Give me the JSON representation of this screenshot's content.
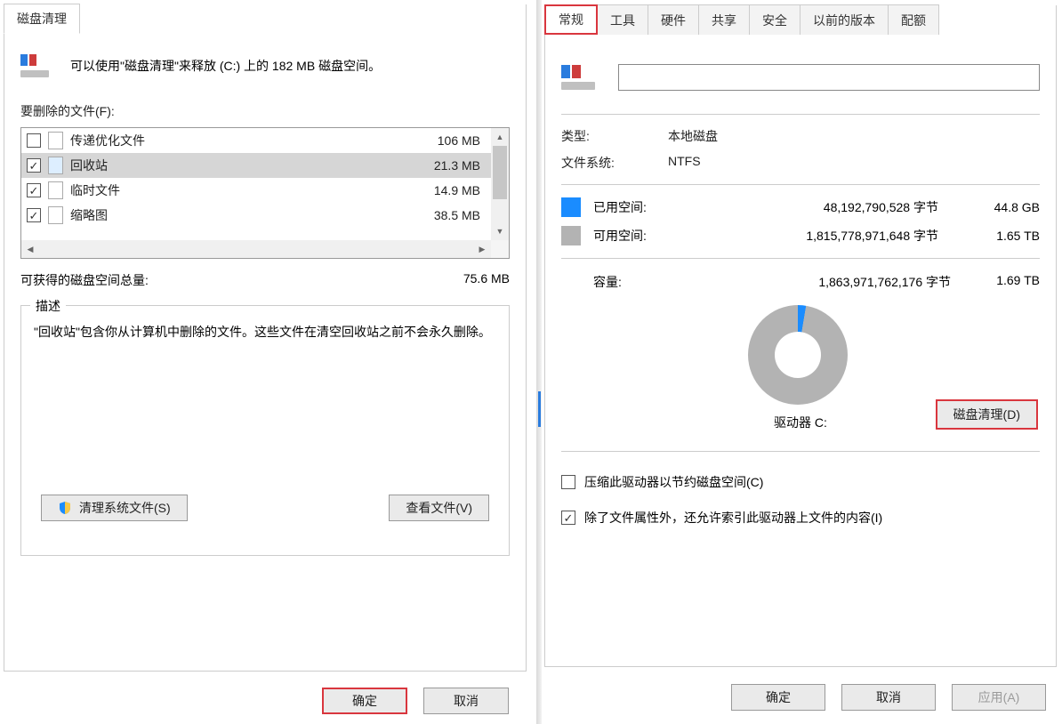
{
  "left": {
    "tab": "磁盘清理",
    "intro": "可以使用\"磁盘清理\"来释放  (C:) 上的 182 MB 磁盘空间。",
    "files_label": "要删除的文件(F):",
    "rows": [
      {
        "checked": false,
        "label": "传递优化文件",
        "size": "106 MB",
        "icon": "file"
      },
      {
        "checked": true,
        "label": "回收站",
        "size": "21.3 MB",
        "icon": "recycle",
        "selected": true
      },
      {
        "checked": true,
        "label": "临时文件",
        "size": "14.9 MB",
        "icon": "file"
      },
      {
        "checked": true,
        "label": "缩略图",
        "size": "38.5 MB",
        "icon": "file"
      }
    ],
    "total_label": "可获得的磁盘空间总量:",
    "total_val": "75.6 MB",
    "desc_title": "描述",
    "desc_text": "\"回收站\"包含你从计算机中删除的文件。这些文件在清空回收站之前不会永久删除。",
    "clean_sys": "清理系统文件(S)",
    "view_files": "查看文件(V)",
    "ok": "确定",
    "cancel": "取消"
  },
  "right": {
    "tabs": [
      "常规",
      "工具",
      "硬件",
      "共享",
      "安全",
      "以前的版本",
      "配额"
    ],
    "active_tab": 0,
    "type_label": "类型:",
    "type_val": "本地磁盘",
    "fs_label": "文件系统:",
    "fs_val": "NTFS",
    "used_label": "已用空间:",
    "used_bytes": "48,192,790,528 字节",
    "used_h": "44.8 GB",
    "free_label": "可用空间:",
    "free_bytes": "1,815,778,971,648 字节",
    "free_h": "1.65 TB",
    "cap_label": "容量:",
    "cap_bytes": "1,863,971,762,176 字节",
    "cap_h": "1.69 TB",
    "drive_label": "驱动器 C:",
    "cleanup_btn": "磁盘清理(D)",
    "compress_label": "压缩此驱动器以节约磁盘空间(C)",
    "index_label": "除了文件属性外，还允许索引此驱动器上文件的内容(I)",
    "ok": "确定",
    "cancel": "取消",
    "apply": "应用(A)"
  },
  "chart_data": {
    "type": "pie",
    "title": "驱动器 C:",
    "series": [
      {
        "name": "已用空间",
        "value": 48192790528,
        "human": "44.8 GB",
        "color": "#1a8cff"
      },
      {
        "name": "可用空间",
        "value": 1815778971648,
        "human": "1.65 TB",
        "color": "#b3b3b3"
      }
    ],
    "total": {
      "name": "容量",
      "value": 1863971762176,
      "human": "1.69 TB"
    }
  }
}
